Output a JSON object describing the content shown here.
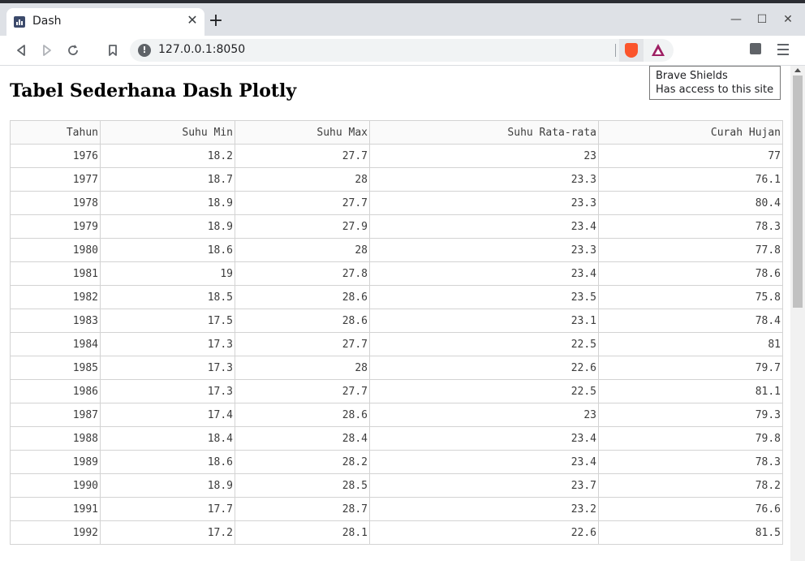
{
  "browser": {
    "tab_title": "Dash",
    "tab_close": "✕",
    "new_tab": "+",
    "window_controls": {
      "minimize": "—",
      "maximize": "☐",
      "close": "✕"
    },
    "url": "127.0.0.1:8050",
    "icons": [
      "back-icon",
      "forward-icon",
      "reload-icon",
      "bookmark-icon",
      "site-info-icon",
      "brave-shields-icon",
      "brave-rewards-icon",
      "extensions-icon",
      "menu-icon"
    ]
  },
  "tooltip": {
    "line1": "Brave Shields",
    "line2": "Has access to this site"
  },
  "page": {
    "title": "Tabel Sederhana Dash Plotly"
  },
  "table": {
    "columns": [
      "Tahun",
      "Suhu Min",
      "Suhu Max",
      "Suhu Rata-rata",
      "Curah Hujan"
    ],
    "rows": [
      [
        "1976",
        "18.2",
        "27.7",
        "23",
        "77"
      ],
      [
        "1977",
        "18.7",
        "28",
        "23.3",
        "76.1"
      ],
      [
        "1978",
        "18.9",
        "27.7",
        "23.3",
        "80.4"
      ],
      [
        "1979",
        "18.9",
        "27.9",
        "23.4",
        "78.3"
      ],
      [
        "1980",
        "18.6",
        "28",
        "23.3",
        "77.8"
      ],
      [
        "1981",
        "19",
        "27.8",
        "23.4",
        "78.6"
      ],
      [
        "1982",
        "18.5",
        "28.6",
        "23.5",
        "75.8"
      ],
      [
        "1983",
        "17.5",
        "28.6",
        "23.1",
        "78.4"
      ],
      [
        "1984",
        "17.3",
        "27.7",
        "22.5",
        "81"
      ],
      [
        "1985",
        "17.3",
        "28",
        "22.6",
        "79.7"
      ],
      [
        "1986",
        "17.3",
        "27.7",
        "22.5",
        "81.1"
      ],
      [
        "1987",
        "17.4",
        "28.6",
        "23",
        "79.3"
      ],
      [
        "1988",
        "18.4",
        "28.4",
        "23.4",
        "79.8"
      ],
      [
        "1989",
        "18.6",
        "28.2",
        "23.4",
        "78.3"
      ],
      [
        "1990",
        "18.9",
        "28.5",
        "23.7",
        "78.2"
      ],
      [
        "1991",
        "17.7",
        "28.7",
        "23.2",
        "76.6"
      ],
      [
        "1992",
        "17.2",
        "28.1",
        "22.6",
        "81.5"
      ]
    ]
  }
}
